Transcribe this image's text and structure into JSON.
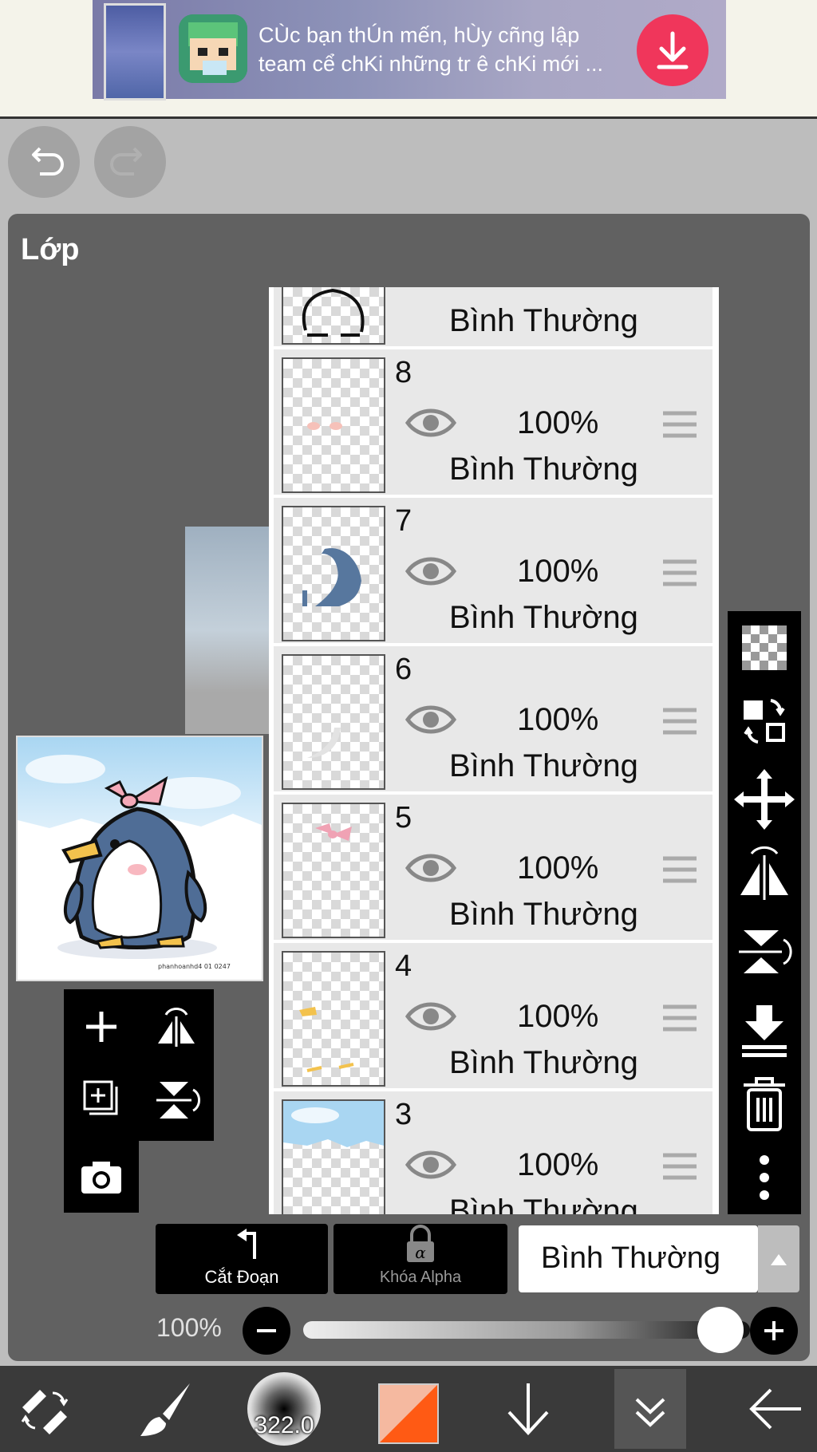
{
  "ad": {
    "text": "CÙc bạn thÚn mến, hÙy cñng lập team cể chKi những tr ê chKi mới ...",
    "download_icon": "download-arrow-icon"
  },
  "history": {
    "undo_icon": "undo-icon",
    "redo_icon": "redo-icon"
  },
  "panel": {
    "title": "Lớp",
    "layers": [
      {
        "number": "",
        "opacity": "",
        "blend": "Bình Thường",
        "thumb": "penguin-outline"
      },
      {
        "number": "8",
        "opacity": "100%",
        "blend": "Bình Thường",
        "thumb": "blush"
      },
      {
        "number": "7",
        "opacity": "100%",
        "blend": "Bình Thường",
        "thumb": "blue-wing"
      },
      {
        "number": "6",
        "opacity": "100%",
        "blend": "Bình Thường",
        "thumb": "white-curve"
      },
      {
        "number": "5",
        "opacity": "100%",
        "blend": "Bình Thường",
        "thumb": "pink-bow"
      },
      {
        "number": "4",
        "opacity": "100%",
        "blend": "Bình Thường",
        "thumb": "yellow-beak-feet"
      },
      {
        "number": "3",
        "opacity": "100%",
        "blend": "Bình Thường",
        "thumb": "sky-clouds"
      }
    ],
    "preview_caption": "phanhoanhd4 01 0247"
  },
  "controls": {
    "clipping_label": "Cắt Đoạn",
    "alpha_lock_label": "Khóa Alpha",
    "blend_mode": "Bình Thường",
    "opacity_label": "100%",
    "opacity_value": 1.0
  },
  "bottombar": {
    "brush_size": "322.0",
    "primary_color": "#ff5a14"
  },
  "colors": {
    "panel": "#616161",
    "accent_ad": "#f0365b"
  }
}
